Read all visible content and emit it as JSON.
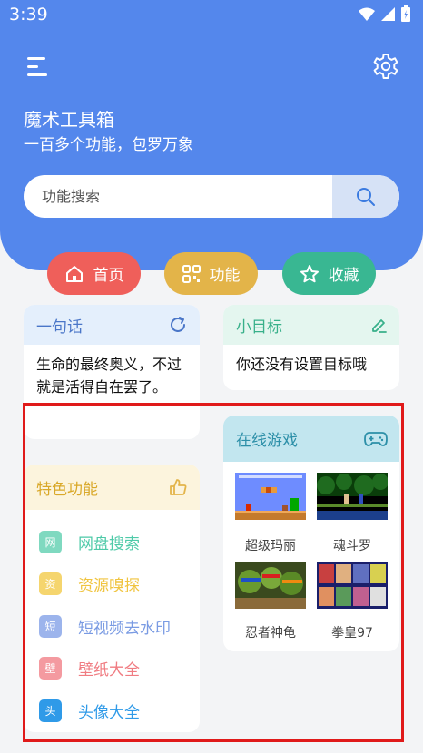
{
  "status": {
    "time": "3:39"
  },
  "header": {
    "title": "魔术工具箱",
    "subtitle": "一百多个功能，包罗万象"
  },
  "search": {
    "placeholder": "功能搜索"
  },
  "nav": [
    {
      "label": "首页",
      "color": "#ef5f5a"
    },
    {
      "label": "功能",
      "color": "#e3b449"
    },
    {
      "label": "收藏",
      "color": "#39b792"
    }
  ],
  "quote_card": {
    "title": "一句话",
    "text": "生命的最终奥义，不过就是活得自在罢了。"
  },
  "goal_card": {
    "title": "小目标",
    "text": "你还没有设置目标哦"
  },
  "feature_card": {
    "title": "特色功能",
    "items": [
      {
        "badge": "网",
        "label": "网盘搜索",
        "color": "#4ecaa8"
      },
      {
        "badge": "资",
        "label": "资源嗅探",
        "color": "#f0c440"
      },
      {
        "badge": "短",
        "label": "短视频去水印",
        "color": "#7a9be3"
      },
      {
        "badge": "壁",
        "label": "壁纸大全",
        "color": "#f07c82"
      },
      {
        "badge": "头",
        "label": "头像大全",
        "color": "#2f9ae8"
      }
    ]
  },
  "games_card": {
    "title": "在线游戏",
    "games": [
      {
        "label": "超级玛丽"
      },
      {
        "label": "魂斗罗"
      },
      {
        "label": "忍者神龟"
      },
      {
        "label": "拳皇97"
      }
    ]
  }
}
